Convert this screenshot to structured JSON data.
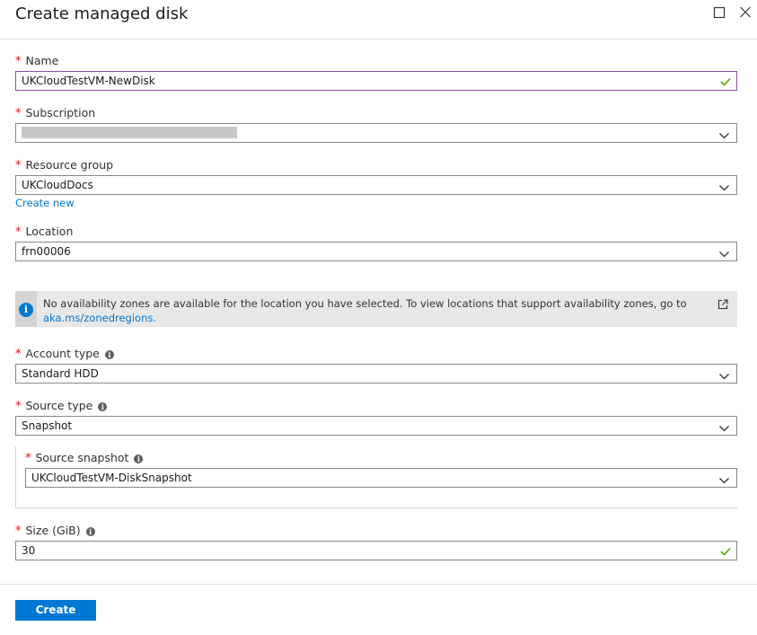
{
  "header": {
    "title": "Create managed disk"
  },
  "fields": {
    "name": {
      "label": "Name",
      "value": "UKCloudTestVM-NewDisk"
    },
    "subscription": {
      "label": "Subscription",
      "value": ""
    },
    "resource_group": {
      "label": "Resource group",
      "value": "UKCloudDocs",
      "create_new": "Create new"
    },
    "location": {
      "label": "Location",
      "value": "frn00006"
    },
    "account_type": {
      "label": "Account type",
      "value": "Standard HDD"
    },
    "source_type": {
      "label": "Source type",
      "value": "Snapshot"
    },
    "source_snapshot": {
      "label": "Source snapshot",
      "value": "UKCloudTestVM-DiskSnapshot"
    },
    "size": {
      "label": "Size (GiB)",
      "value": "30"
    }
  },
  "info_bar": {
    "message": "No availability zones are available for the location you have selected. To view locations that support availability zones, go to",
    "link": "aka.ms/zonedregions."
  },
  "footer": {
    "create_label": "Create"
  },
  "colors": {
    "accent": "#0078d4",
    "required": "#e00b1c",
    "valid": "#57a300",
    "focus_border": "#8e4e9c"
  },
  "icons": [
    "maximize-icon",
    "close-icon",
    "chevron-down-icon",
    "checkmark-icon",
    "info-icon",
    "external-link-icon"
  ]
}
